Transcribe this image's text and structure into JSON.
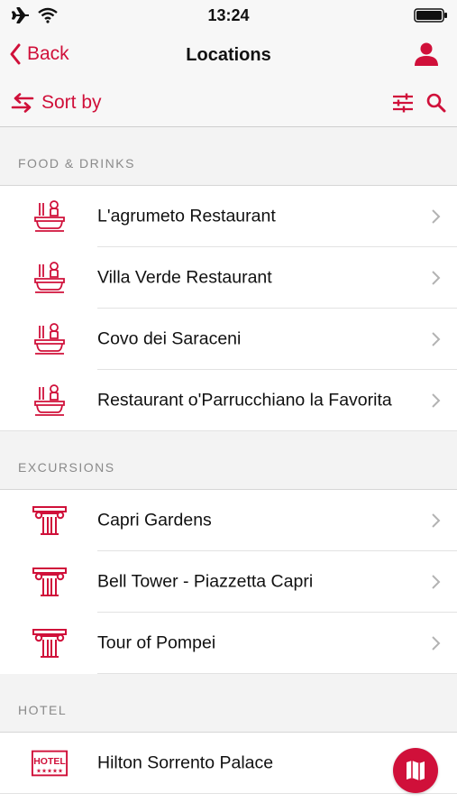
{
  "status_bar": {
    "time": "13:24"
  },
  "nav": {
    "back_label": "Back",
    "title": "Locations"
  },
  "toolbar": {
    "sort_label": "Sort by"
  },
  "colors": {
    "accent": "#d0103a"
  },
  "sections": [
    {
      "title": "FOOD & DRINKS",
      "icon": "restaurant-icon",
      "items": [
        "L'agrumeto Restaurant",
        "Villa Verde Restaurant",
        "Covo dei Saraceni",
        "Restaurant o'Parrucchiano la Favorita"
      ]
    },
    {
      "title": "EXCURSIONS",
      "icon": "column-icon",
      "items": [
        "Capri Gardens",
        "Bell Tower - Piazzetta Capri",
        "Tour of Pompei"
      ]
    },
    {
      "title": "HOTEL",
      "icon": "hotel-icon",
      "items": [
        "Hilton Sorrento Palace"
      ]
    }
  ],
  "hotel_icon_text": "HOTEL"
}
